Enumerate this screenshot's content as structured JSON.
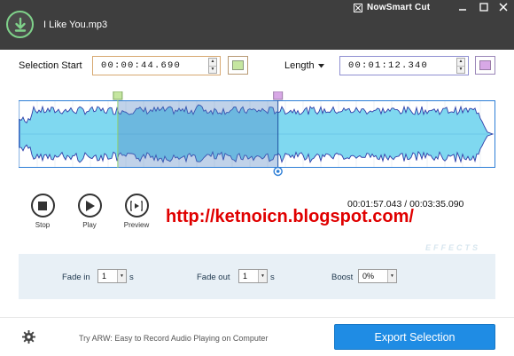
{
  "app": {
    "name": "NowSmart Cut",
    "file_name": "I Like You.mp3"
  },
  "window_controls": {
    "minimize": "–",
    "maximize": "□",
    "close": "✕"
  },
  "selection": {
    "start_label": "Selection Start",
    "start_value": "00:00:44.690",
    "start_marker_color": "#c5e6a0",
    "length_label": "Length",
    "length_value": "00:01:12.340",
    "end_marker_color": "#d8a8e6"
  },
  "waveform": {
    "selection_start_fraction": 0.208,
    "selection_end_fraction": 0.544,
    "wave_color": "#2f3da8",
    "fill_color": "#7fd8f0",
    "selection_overlay": "#4a7ec0"
  },
  "playback": {
    "stop_label": "Stop",
    "play_label": "Play",
    "preview_label": "Preview",
    "current_time": "00:01:57.043",
    "separator": "/",
    "total_time": "00:03:35.090"
  },
  "watermark": "http://ketnoicn.blogspot.com/",
  "effects": {
    "tag": "EFFECTS",
    "fade_in_label": "Fade in",
    "fade_in_value": "1",
    "fade_in_unit": "s",
    "fade_out_label": "Fade out",
    "fade_out_value": "1",
    "fade_out_unit": "s",
    "boost_label": "Boost",
    "boost_value": "0%"
  },
  "footer": {
    "promo_text": "Try ARW: Easy to Record Audio Playing on Computer",
    "export_label": "Export Selection"
  },
  "colors": {
    "titlebar": "#3e3e3e",
    "accent": "#1f8ce4",
    "logo_ring": "#7fd18a"
  }
}
